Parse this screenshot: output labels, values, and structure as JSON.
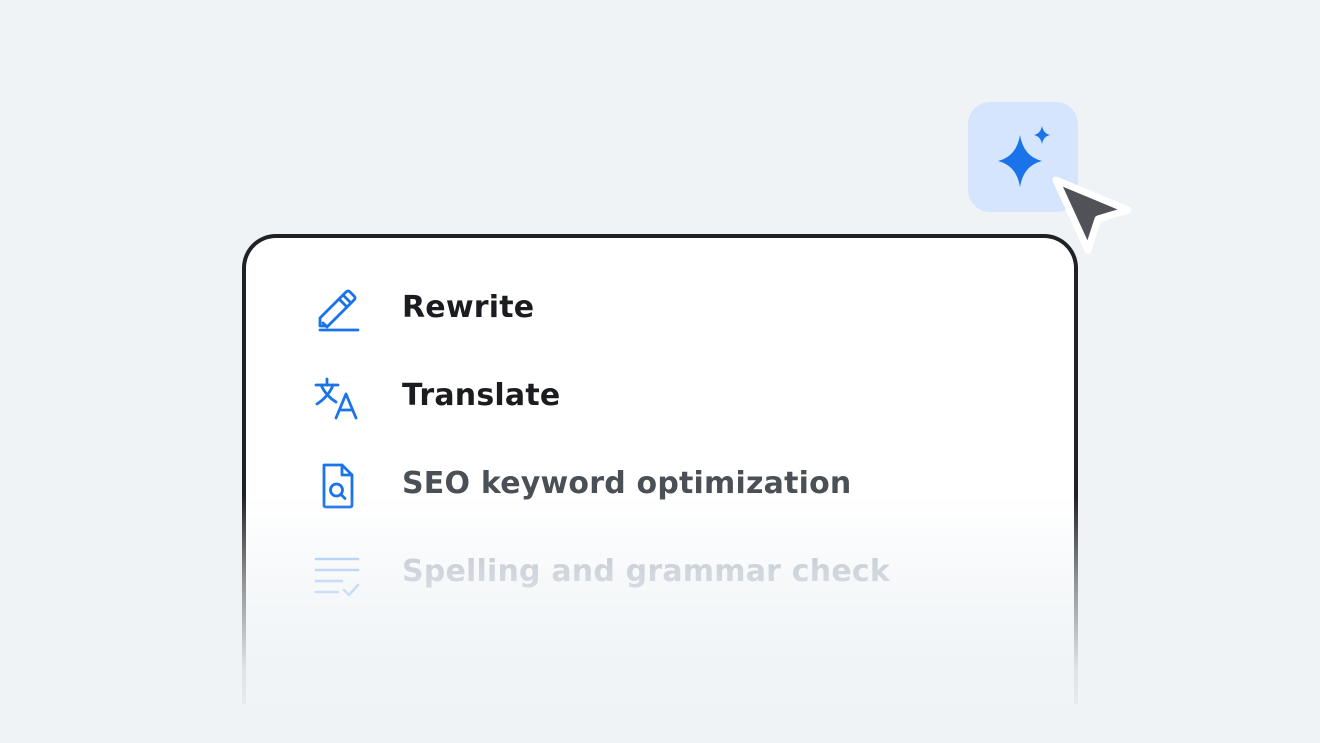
{
  "menu": {
    "items": [
      {
        "label": "Rewrite",
        "icon": "pencil-edit-icon"
      },
      {
        "label": "Translate",
        "icon": "translate-icon"
      },
      {
        "label": "SEO keyword optimization",
        "icon": "document-search-icon"
      },
      {
        "label": "Spelling and grammar check",
        "icon": "text-check-icon"
      }
    ]
  },
  "ai_button": {
    "icon": "sparkle-icon"
  },
  "cursor": {
    "icon": "cursor-pointer-icon"
  },
  "colors": {
    "background": "#eff3f6",
    "card": "#ffffff",
    "card_border": "#202124",
    "accent_blue": "#1a73e8",
    "ai_button_bg": "#d4e5fd",
    "cursor": "#505258",
    "text_primary": "#1b1c1f",
    "text_secondary": "#4b4f56",
    "text_faded": "#b3bac3"
  }
}
